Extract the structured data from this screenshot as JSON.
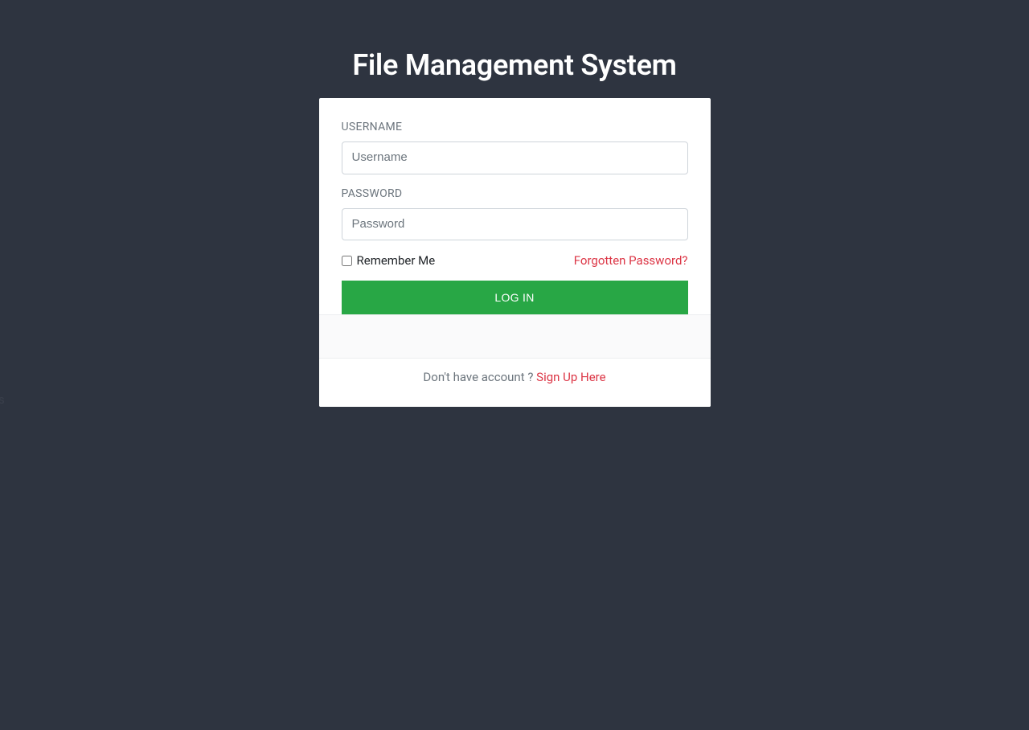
{
  "header": {
    "title": "File Management System"
  },
  "form": {
    "username_label": "USERNAME",
    "username_placeholder": "Username",
    "password_label": "PASSWORD",
    "password_placeholder": "Password",
    "remember_label": "Remember Me",
    "forgot_label": "Forgotten Password?",
    "login_button_label": "LOG IN"
  },
  "footer": {
    "prompt_text": "Don't have account ? ",
    "signup_link_label": "Sign Up Here"
  }
}
